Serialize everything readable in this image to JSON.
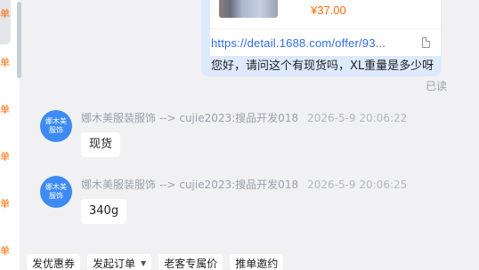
{
  "sidebar": {
    "chars": [
      "单",
      "单",
      "单",
      "单",
      "单",
      "单"
    ]
  },
  "product_message": {
    "price": "¥37.00",
    "link": "https://detail.1688.com/offer/93...",
    "text": "您好，请问这个有现货吗，XL重量是多少呀",
    "read_status": "已读"
  },
  "messages": [
    {
      "avatar": "娜木美服饰",
      "sender": "娜木美服装服饰 --> cujie2023:搜品开发018",
      "time": "2026-5-9 20:06:22",
      "text": "现货"
    },
    {
      "avatar": "娜木美服饰",
      "sender": "娜木美服装服饰 --> cujie2023:搜品开发018",
      "time": "2026-5-9 20:06:25",
      "text": "340g"
    }
  ],
  "toolbar": {
    "coupon": "发优惠券",
    "order": "发起订单",
    "order_caret": "▼",
    "loyal_price": "老客专属价",
    "promote": "推单邀约"
  },
  "colors": {
    "accent": "#ff6a00",
    "link": "#2f6be3",
    "avatar": "#3d8bf2",
    "bubble": "#ddeafe"
  }
}
